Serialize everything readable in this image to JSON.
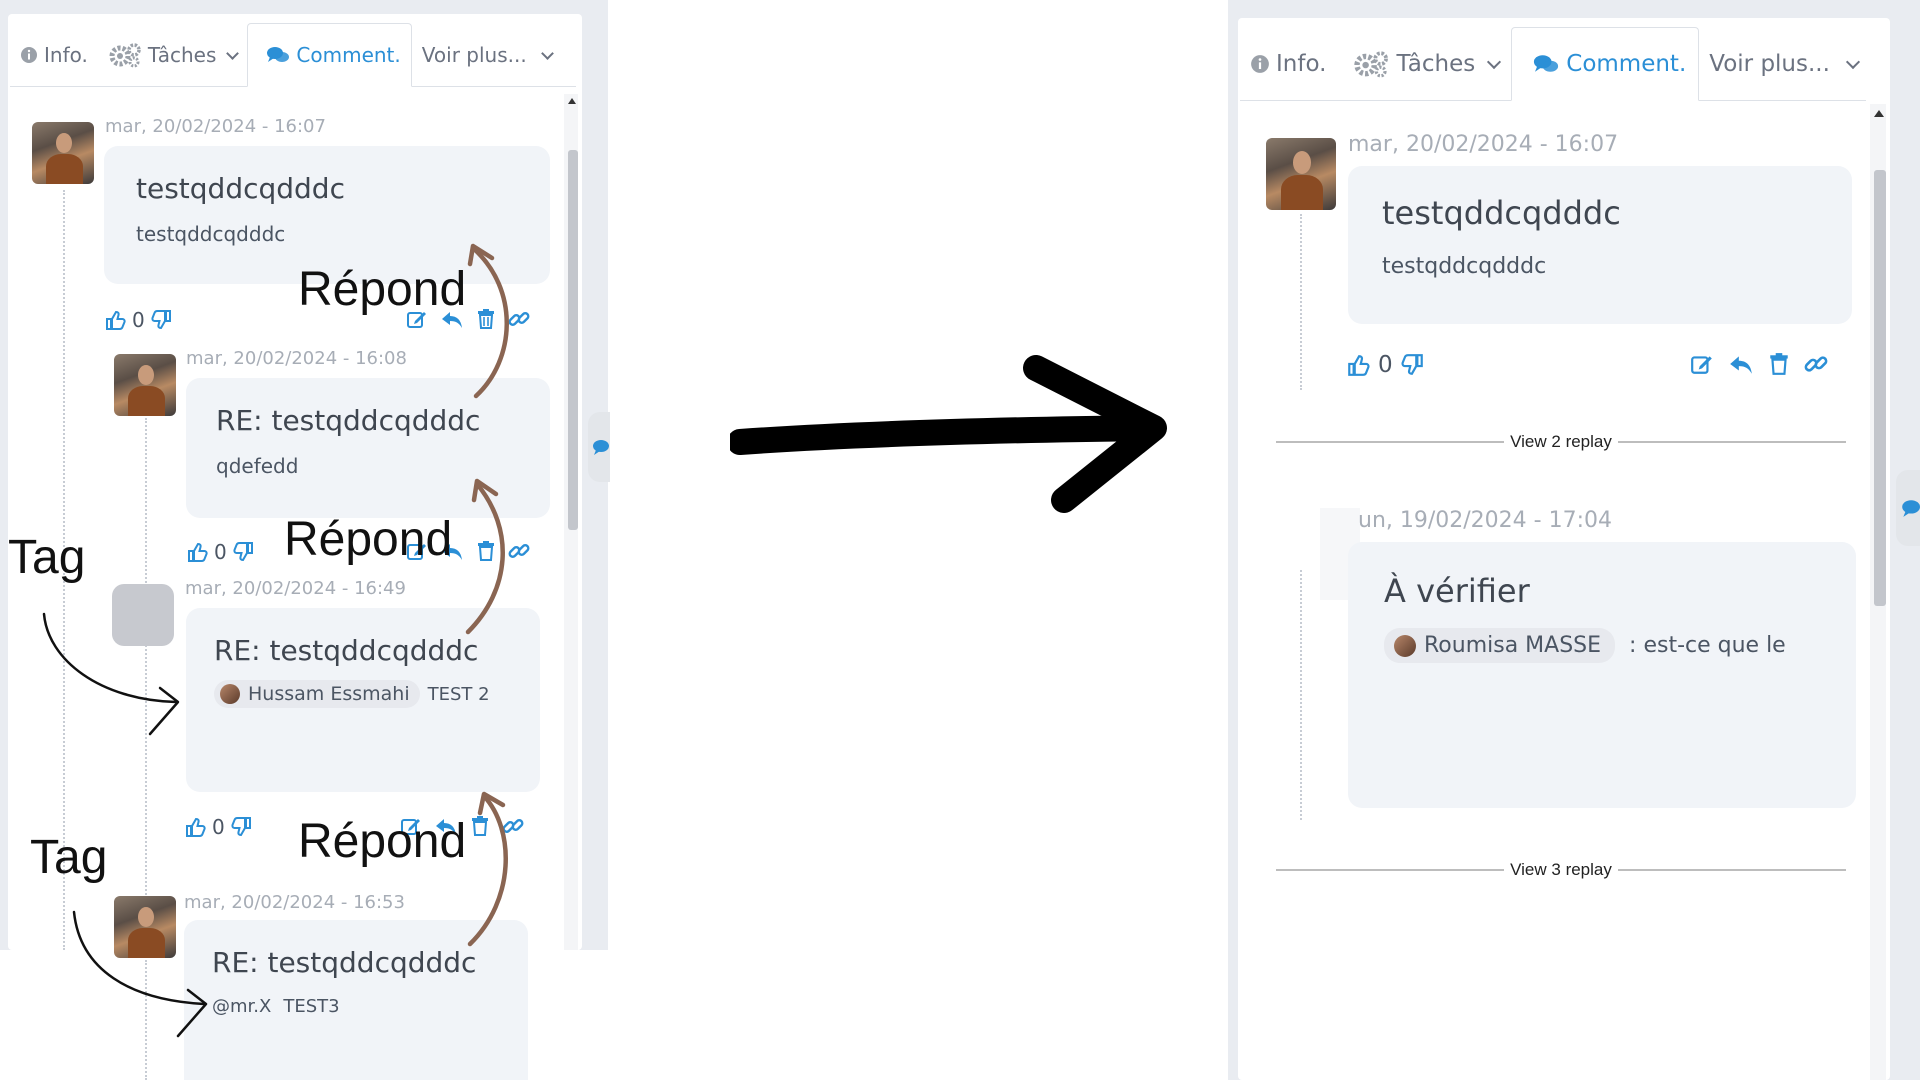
{
  "tabs": {
    "info": "Info.",
    "taches": "Tâches",
    "comment": "Comment.",
    "more": "Voir plus..."
  },
  "left_comments": [
    {
      "date": "mar, 20/02/2024 - 16:07",
      "title": "testqddcqdddc",
      "body": "testqddcqdddc",
      "likes": "0"
    },
    {
      "date": "mar, 20/02/2024 - 16:08",
      "title": "RE: testqddcqdddc",
      "body": "qdefedd",
      "likes": "0"
    },
    {
      "date": "mar, 20/02/2024 - 16:49",
      "title": "RE: testqddcqdddc",
      "mention": "Hussam Essmahi",
      "body_after": "TEST 2",
      "likes": "0"
    },
    {
      "date": "mar, 20/02/2024 - 16:53",
      "title": "RE: testqddcqdddc",
      "mention": "@mr.X",
      "body_after": "TEST3"
    }
  ],
  "right": {
    "comment1": {
      "date": "mar, 20/02/2024 - 16:07",
      "title": "testqddcqdddc",
      "body": "testqddcqdddc",
      "likes": "0"
    },
    "replay1": "View 2 replay",
    "comment2": {
      "date": "un, 19/02/2024 - 17:04",
      "title": "À vérifier",
      "mention": "Roumisa MASSE",
      "body_after": ": est-ce que le"
    },
    "replay2": "View 3 replay"
  },
  "annotations": {
    "repond": "Répond",
    "tag": "Tag"
  },
  "colors": {
    "accent": "#2b8fd6",
    "bubble": "#f1f4f8",
    "annotation_arrow": "#8a6552"
  },
  "icons": [
    "info-icon",
    "gears-icon",
    "comments-icon",
    "chevron-down-icon",
    "thumbs-up-icon",
    "thumbs-down-icon",
    "edit-icon",
    "reply-icon",
    "trash-icon",
    "link-icon"
  ]
}
